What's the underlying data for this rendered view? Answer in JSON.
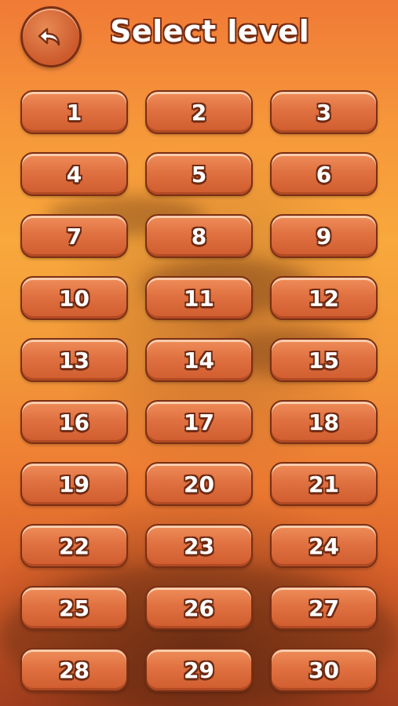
{
  "header": {
    "title": "Select level",
    "back_icon": "back-arrow-icon"
  },
  "levels": [
    "1",
    "2",
    "3",
    "4",
    "5",
    "6",
    "7",
    "8",
    "9",
    "10",
    "11",
    "12",
    "13",
    "14",
    "15",
    "16",
    "17",
    "18",
    "19",
    "20",
    "21",
    "22",
    "23",
    "24",
    "25",
    "26",
    "27",
    "28",
    "29",
    "30"
  ],
  "colors": {
    "button_fill": "#e07141",
    "button_border": "#7a2f14",
    "background_top": "#f07a36",
    "background_bottom": "#a8401e"
  }
}
